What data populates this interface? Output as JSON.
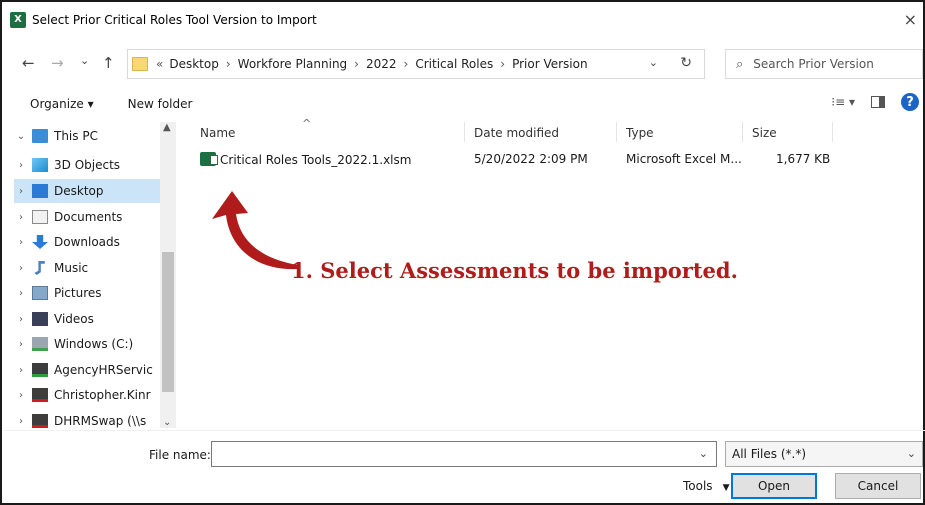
{
  "window": {
    "app_icon": "X",
    "title": "Select Prior Critical Roles Tool Version to Import",
    "close_glyph": "×"
  },
  "nav": {
    "back": "←",
    "forward": "→",
    "recent": "⌄",
    "up": "↑",
    "overflow": "«",
    "breadcrumbs": [
      "Desktop",
      "Workfore Planning",
      "2022",
      "Critical Roles",
      "Prior Version"
    ],
    "separator": "›",
    "dropdown": "⌄",
    "refresh": "↻",
    "search_icon": "⌕",
    "search_placeholder": "Search Prior Version"
  },
  "commands": {
    "organize": "Organize ▾",
    "new_folder": "New folder",
    "view": "⁝≡ ▾",
    "help": "?"
  },
  "sidebar": {
    "items": [
      {
        "chev": "⌄",
        "label": "This PC",
        "icon": "pc-icon"
      },
      {
        "chev": "›",
        "label": "3D Objects",
        "icon": "3d-objects-icon"
      },
      {
        "chev": "›",
        "label": "Desktop",
        "icon": "desktop-icon",
        "selected": true
      },
      {
        "chev": "›",
        "label": "Documents",
        "icon": "documents-icon"
      },
      {
        "chev": "›",
        "label": "Downloads",
        "icon": "downloads-icon"
      },
      {
        "chev": "›",
        "label": "Music",
        "icon": "music-icon"
      },
      {
        "chev": "›",
        "label": "Pictures",
        "icon": "pictures-icon"
      },
      {
        "chev": "›",
        "label": "Videos",
        "icon": "videos-icon"
      },
      {
        "chev": "›",
        "label": "Windows (C:)",
        "icon": "drive-icon"
      },
      {
        "chev": "›",
        "label": "AgencyHRServic",
        "icon": "network-drive-icon"
      },
      {
        "chev": "›",
        "label": "Christopher.Kinr",
        "icon": "disconnected-drive-icon"
      },
      {
        "chev": "›",
        "label": "DHRMSwap (\\\\s",
        "icon": "disconnected-drive-icon"
      }
    ],
    "scroll_up": "▲",
    "scroll_down": "⌄"
  },
  "columns": {
    "name": "Name",
    "date": "Date modified",
    "type": "Type",
    "size": "Size",
    "sort_caret": "^"
  },
  "files": [
    {
      "name": "Critical Roles Tools_2022.1.xlsm",
      "date": "5/20/2022 2:09 PM",
      "type": "Microsoft Excel M...",
      "size": "1,677 KB"
    }
  ],
  "annotation": {
    "text": "1. Select Assessments to be imported.",
    "color": "#b01c1c"
  },
  "footer": {
    "file_name_label": "File name:",
    "file_name_value": "",
    "filter_value": "All Files (*.*)",
    "dropdown": "⌄",
    "tools": "Tools",
    "tools_caret": "▼",
    "open": "Open",
    "cancel": "Cancel"
  }
}
